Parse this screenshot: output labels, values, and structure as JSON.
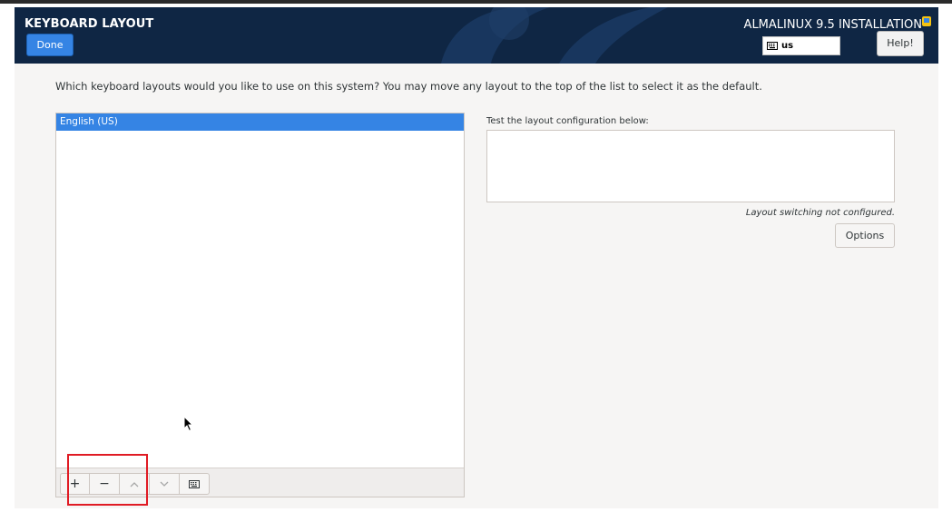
{
  "header": {
    "title": "KEYBOARD LAYOUT",
    "done_label": "Done",
    "product": "ALMALINUX 9.5 INSTALLATION",
    "keyboard_indicator": "us",
    "help_label": "Help!"
  },
  "instructions": "Which keyboard layouts would you like to use on this system?  You may move any layout to the top of the list to select it as the default.",
  "layouts": [
    {
      "label": "English (US)",
      "selected": true
    }
  ],
  "toolbar": {
    "buttons": [
      {
        "name": "add-layout-button",
        "glyph": "+",
        "enabled": true
      },
      {
        "name": "remove-layout-button",
        "glyph": "−",
        "enabled": true
      },
      {
        "name": "move-up-button",
        "glyph": "chevron-up-icon",
        "enabled": false
      },
      {
        "name": "move-down-button",
        "glyph": "chevron-down-icon",
        "enabled": false
      },
      {
        "name": "preview-layout-button",
        "glyph": "keyboard-icon",
        "enabled": true
      }
    ]
  },
  "test": {
    "label": "Test the layout configuration below:",
    "value": ""
  },
  "switching_note": "Layout switching not configured.",
  "options_label": "Options",
  "colors": {
    "header_bg": "#0f2644",
    "accent": "#3584e4",
    "highlight": "#e01b24"
  }
}
